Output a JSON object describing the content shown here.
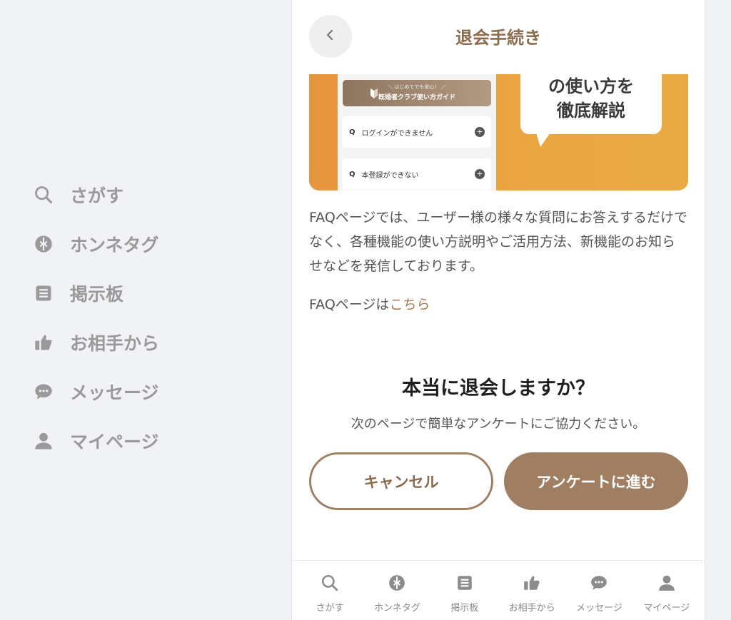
{
  "sidenav": {
    "items": [
      {
        "label": "さがす",
        "icon": "search-icon"
      },
      {
        "label": "ホンネタグ",
        "icon": "tag-icon"
      },
      {
        "label": "掲示板",
        "icon": "board-icon"
      },
      {
        "label": "お相手から",
        "icon": "thumbs-up-icon"
      },
      {
        "label": "メッセージ",
        "icon": "chat-icon"
      },
      {
        "label": "マイページ",
        "icon": "person-icon"
      }
    ]
  },
  "header": {
    "title": "退会手続き"
  },
  "banner": {
    "guide_sub": "＼ はじめてでも安心！ ／",
    "guide_title": "既婚者クラブ使い方ガイド",
    "questions": [
      {
        "q": "Q",
        "text": "ログインができません"
      },
      {
        "q": "Q",
        "text": "本登録ができない"
      }
    ],
    "bubble_line1": "の使い方を",
    "bubble_line2": "徹底解説"
  },
  "content": {
    "description": "FAQページでは、ユーザー様の様々な質問にお答えするだけでなく、各種機能の使い方説明やご活用方法、新機能のお知らせなどを発信しております。",
    "faq_prefix": "FAQページは",
    "faq_link": "こちら",
    "confirm_title": "本当に退会しますか？",
    "confirm_sub": "次のページで簡単なアンケートにご協力ください。",
    "cancel_label": "キャンセル",
    "next_label": "アンケートに進む"
  },
  "tabbar": {
    "items": [
      {
        "label": "さがす"
      },
      {
        "label": "ホンネタグ"
      },
      {
        "label": "掲示板"
      },
      {
        "label": "お相手から"
      },
      {
        "label": "メッセージ"
      },
      {
        "label": "マイページ"
      }
    ]
  },
  "colors": {
    "accent": "#a07e61",
    "title_brown": "#8a6b4e",
    "link": "#a57d58",
    "banner_orange": "#e9a440"
  }
}
